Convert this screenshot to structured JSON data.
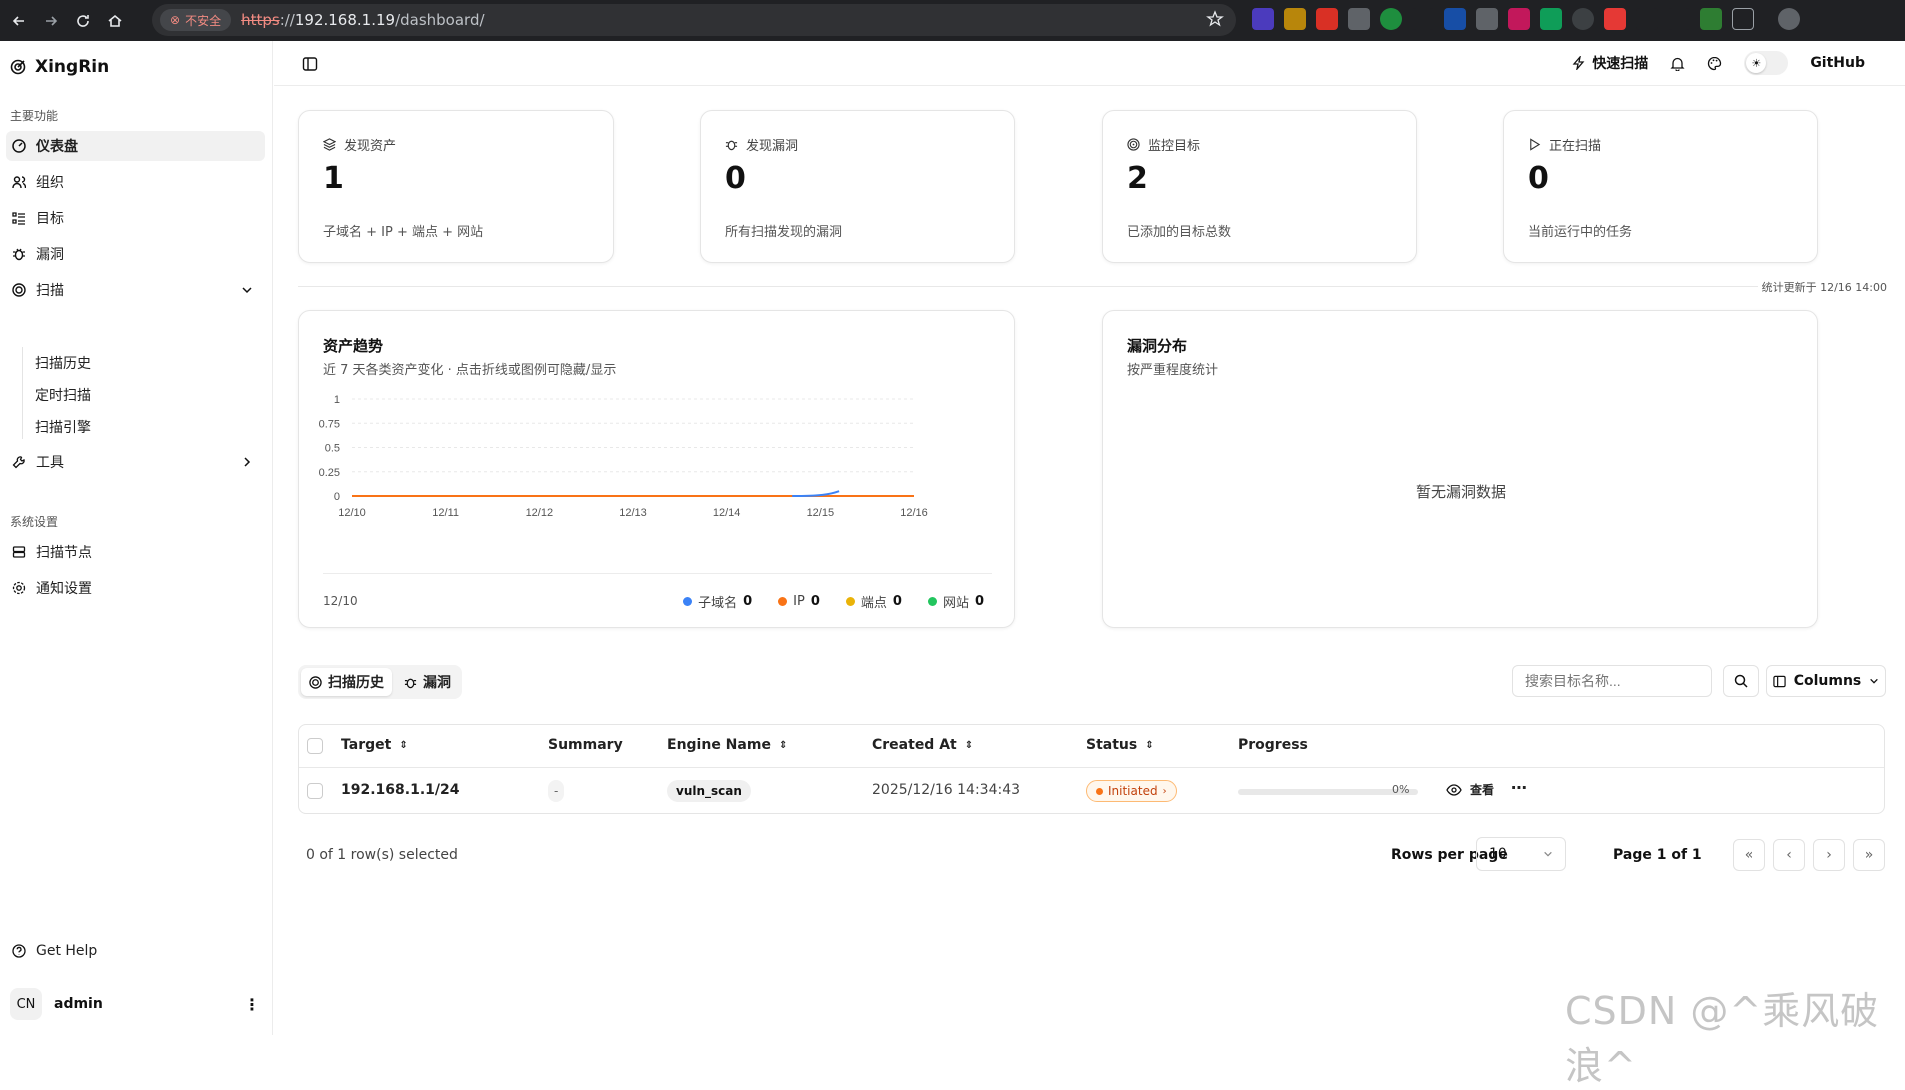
{
  "browser": {
    "insecure_label": "不安全",
    "url_scheme": "https",
    "url_sep": "://",
    "url_host": "192.168.1.19",
    "url_path": "/dashboard/"
  },
  "sidebar": {
    "brand": "XingRin",
    "section_main": "主要功能",
    "items": [
      {
        "label": "仪表盘"
      },
      {
        "label": "组织"
      },
      {
        "label": "目标"
      },
      {
        "label": "漏洞"
      },
      {
        "label": "扫描"
      },
      {
        "label": "工具"
      }
    ],
    "scan_sub": [
      "扫描历史",
      "定时扫描",
      "扫描引擎"
    ],
    "section_settings": "系统设置",
    "settings_items": [
      {
        "label": "扫描节点"
      },
      {
        "label": "通知设置"
      }
    ],
    "help": "Get Help",
    "user_initials": "CN",
    "user_name": "admin"
  },
  "topbar": {
    "quick_scan": "快速扫描",
    "github": "GitHub"
  },
  "stats": [
    {
      "label": "发现资产",
      "value": "1",
      "desc": "子域名 + IP + 端点 + 网站"
    },
    {
      "label": "发现漏洞",
      "value": "0",
      "desc": "所有扫描发现的漏洞"
    },
    {
      "label": "监控目标",
      "value": "2",
      "desc": "已添加的目标总数"
    },
    {
      "label": "正在扫描",
      "value": "0",
      "desc": "当前运行中的任务"
    }
  ],
  "updated": "统计更新于 12/16 14:00",
  "trend": {
    "title": "资产趋势",
    "subtitle": "近 7 天各类资产变化 · 点击折线或图例可隐藏/显示",
    "footer_date": "12/10"
  },
  "vuln_dist": {
    "title": "漏洞分布",
    "subtitle": "按严重程度统计",
    "empty": "暂无漏洞数据"
  },
  "chart_data": {
    "type": "line",
    "x": [
      "12/10",
      "12/11",
      "12/12",
      "12/13",
      "12/14",
      "12/15",
      "12/16"
    ],
    "series": [
      {
        "name": "子域名",
        "color": "#3b82f6",
        "total": "0",
        "values": [
          0,
          0,
          0,
          0,
          0,
          0,
          0.05
        ]
      },
      {
        "name": "IP",
        "color": "#f97316",
        "total": "0",
        "values": [
          0,
          0,
          0,
          0,
          0,
          0,
          0
        ]
      },
      {
        "name": "端点",
        "color": "#eab308",
        "total": "0",
        "values": [
          0,
          0,
          0,
          0,
          0,
          0,
          0
        ]
      },
      {
        "name": "网站",
        "color": "#22c55e",
        "total": "0",
        "values": [
          0,
          0,
          0,
          0,
          0,
          0,
          0
        ]
      }
    ],
    "y_ticks": [
      "1",
      "0.75",
      "0.5",
      "0.25",
      "0"
    ],
    "ylim": [
      0,
      1
    ],
    "grid": true,
    "legend": "bottom-right"
  },
  "table_section": {
    "tab_history": "扫描历史",
    "tab_vulns": "漏洞",
    "search_placeholder": "搜索目标名称...",
    "columns_label": "Columns",
    "headers": [
      "Target",
      "Summary",
      "Engine Name",
      "Created At",
      "Status",
      "Progress"
    ],
    "rows": [
      {
        "target": "192.168.1.1/24",
        "summary": "-",
        "engine": "vuln_scan",
        "created": "2025/12/16 14:34:43",
        "status": "Initiated",
        "progress": 0,
        "progress_label": "0%",
        "view": "查看"
      }
    ],
    "selected": "0 of 1 row(s) selected",
    "rows_per_page_label": "Rows per page",
    "rows_per_page": "10",
    "page_info": "Page 1 of 1"
  },
  "watermark": "CSDN @^乘风破浪^"
}
